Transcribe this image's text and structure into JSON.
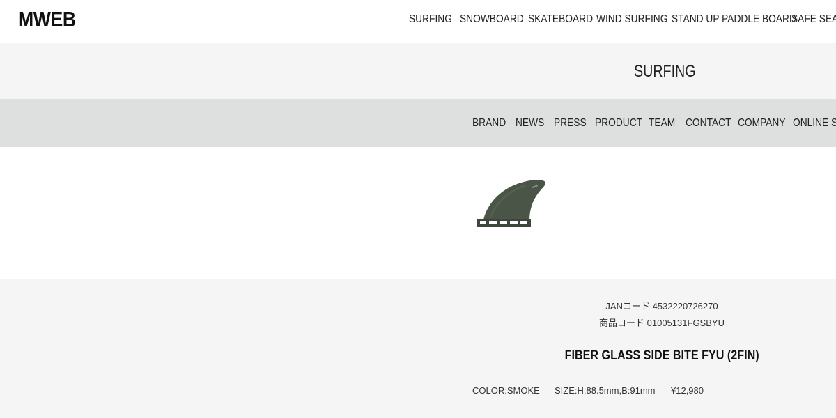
{
  "header": {
    "logo": "MWEB",
    "nav": [
      "SURFING",
      "SNOWBOARD",
      "SKATEBOARD",
      "WIND SURFING",
      "STAND UP PADDLE BOARD",
      "SAFE SEA"
    ]
  },
  "banner": {
    "title": "SURFING"
  },
  "subnav": {
    "items": [
      "BRAND",
      "NEWS",
      "PRESS",
      "PRODUCT",
      "TEAM",
      "CONTACT",
      "COMPANY",
      "ONLINE STORE"
    ]
  },
  "product": {
    "image_icon": "surf-fin-image",
    "jan_code": "JANコード 4532220726270",
    "product_code": "商品コード 01005131FGSBYU",
    "name": "FIBER GLASS SIDE BITE FYU (2FIN)",
    "color": "COLOR:SMOKE",
    "size": "SIZE:H:88.5mm,B:91mm",
    "price": "¥12,980"
  },
  "colors": {
    "banner_bg": "#f5f5f5",
    "subnav_bg": "#dde0df",
    "fin": "#4a5447"
  }
}
